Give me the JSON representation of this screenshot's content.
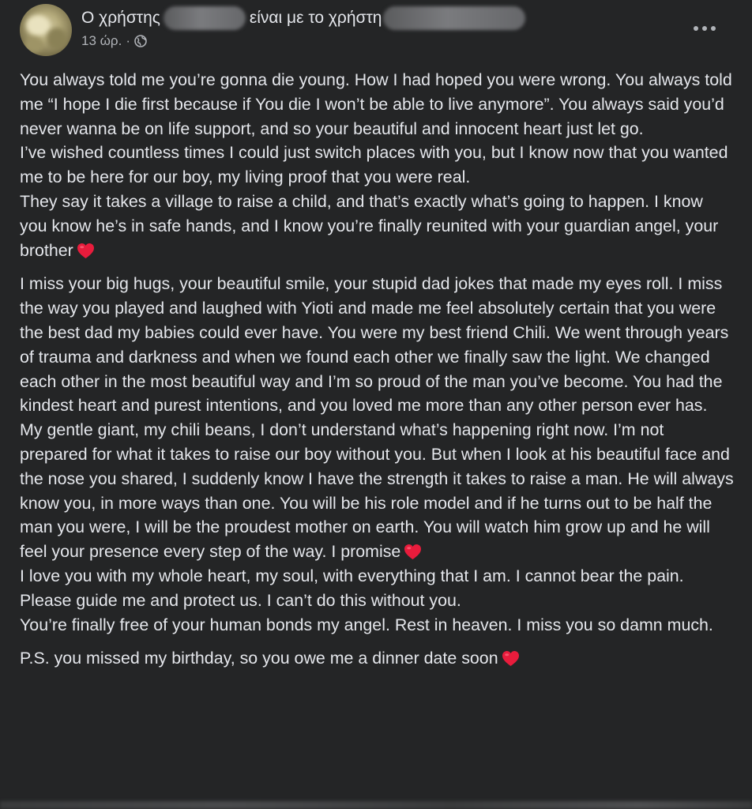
{
  "post": {
    "author_prefix": "Ο χρήστης",
    "with_text": "είναι με το χρήστη",
    "timestamp": "13 ώρ.",
    "separator": "·",
    "privacy_icon": "globe-icon",
    "more_icon": "more-options-icon",
    "heart_icon": "red-heart-emoji",
    "heart_color": "#e81c3c"
  },
  "body": {
    "p1_a": "You always told me you’re gonna die young. How I had hoped you were wrong. You always told me “I hope I die first because if You die I won’t be able to live anymore”. You always said you’d never wanna be on life support, and so your beautiful and innocent heart just let go.",
    "p1_b": "I’ve wished countless times I could just switch places with you, but I know now that you wanted me to be here for our boy, my living proof that you were real.",
    "p1_c": "They say it takes a village to raise a child, and that’s exactly what’s going to happen. I know you know he’s in safe hands, and I know you’re finally reunited with your guardian angel, your brother",
    "p2_a": "I miss your big hugs, your beautiful smile, your stupid dad jokes that made my eyes roll. I miss the way you played and laughed with Yioti and made me feel absolutely certain that you were the best dad my babies could ever have. You were my best friend Chili. We went through years of trauma and darkness and when we found each other we finally saw the light. We changed each other in the most beautiful way and I’m so proud of the man you’ve become. You had the kindest heart and purest intentions, and you loved me more than any other person ever has.",
    "p2_b": "My gentle giant, my chili beans, I don’t understand what’s happening right now. I’m not prepared for what it takes to raise our boy without you. But when I look at his beautiful face and the nose you shared, I suddenly know I have the strength it takes to raise a man. He will always know you, in more ways than one. You will be his role model and if he turns out to be half the man you were, I will be the proudest mother on earth. You will watch him grow up and he will feel your presence every step of the way. I promise",
    "p2_c": "I love you with my whole heart, my soul, with everything that I am. I cannot bear the pain. Please guide me and protect us. I can’t do this without you.",
    "p2_d": "You’re finally free of your human bonds my angel. Rest in heaven. I miss you so damn much.",
    "p3": "P.S. you missed my birthday, so you owe me a dinner date soon"
  }
}
